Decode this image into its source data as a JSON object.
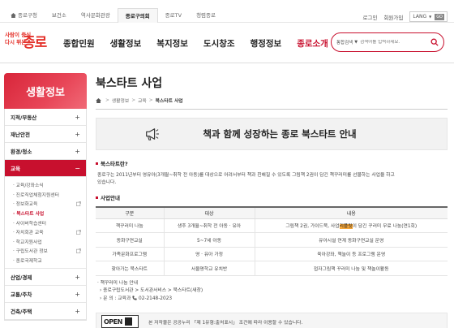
{
  "topnav": {
    "items": [
      {
        "label": "종로구청",
        "active": false
      },
      {
        "label": "보건소",
        "active": false
      },
      {
        "label": "역사문화관광",
        "active": false
      },
      {
        "label": "종로구의회",
        "active": true
      },
      {
        "label": "종로TV",
        "active": false
      },
      {
        "label": "청렴종로",
        "active": false
      }
    ],
    "login": "로그인",
    "join": "회원가입",
    "lang": "LANG",
    "lang_arrow": "▼",
    "go": "GO"
  },
  "header": {
    "logo": {
      "line1": "사람이 중심",
      "line2": "다시 뛰는",
      "name": "종로"
    },
    "gnb": [
      {
        "label": "종합민원",
        "active": false
      },
      {
        "label": "생활정보",
        "active": false
      },
      {
        "label": "복지정보",
        "active": false
      },
      {
        "label": "도시창조",
        "active": false
      },
      {
        "label": "행정정보",
        "active": false
      },
      {
        "label": "종로소개",
        "active": true
      }
    ],
    "search": {
      "scope": "통합검색",
      "arrow": "▼",
      "placeholder": "검색어를 입력하세요."
    }
  },
  "lnb": {
    "title": "생활정보",
    "menus_top": [
      {
        "label": "지적/부동산",
        "toggle": "+"
      },
      {
        "label": "재난안전",
        "toggle": "+"
      },
      {
        "label": "환경/청소",
        "toggle": "+"
      }
    ],
    "active_menu": {
      "label": "교육",
      "toggle": "−"
    },
    "subitems": [
      {
        "label": "· 교육/강좌소식",
        "ext": false,
        "active": false
      },
      {
        "label": "· 진로직업체험지원센터",
        "ext": false,
        "active": false
      },
      {
        "label": "· 정보화교육",
        "ext": true,
        "active": false
      },
      {
        "label": "· 북스타트 사업",
        "ext": false,
        "active": true
      },
      {
        "label": "· 사이버학습센터",
        "ext": false,
        "active": false
      },
      {
        "label": "· 자치회관 교육",
        "ext": true,
        "active": false
      },
      {
        "label": "· 학교지원사업",
        "ext": false,
        "active": false
      },
      {
        "label": "· 구립도서관 정보",
        "ext": true,
        "active": false
      },
      {
        "label": "· 종로국제학교",
        "ext": false,
        "active": false
      }
    ],
    "menus_bottom": [
      {
        "label": "산업/경제",
        "toggle": "+"
      },
      {
        "label": "교통/주차",
        "toggle": "+"
      },
      {
        "label": "건축/주택",
        "toggle": "+"
      }
    ]
  },
  "page": {
    "title": "북스타트 사업",
    "breadcrumb": {
      "home_sep": ">",
      "items": [
        "생활정보",
        "교육"
      ],
      "current": "북스타트 사업"
    },
    "banner": "책과 함께 성장하는 종로 북스타트 안내",
    "section1": {
      "title": "북스타트란?",
      "desc1": "종로구는 2011년부터 영유아(3개월~취학 전 아동)를 대상으로 어려서부터 책과 친해질 수 있도록 그림책 2권이 담긴 책꾸러미를 선물하는 사업을 하고",
      "desc2": "있습니다."
    },
    "section2": {
      "title": "사업안내",
      "headers": [
        "구분",
        "대상",
        "내용"
      ],
      "rows": [
        {
          "kind": "책꾸러미 나눔",
          "target": "생후 3개월~취학 전 아동 · 유아",
          "content_pre": "그림책 2권, 가이드북, 사업",
          "content_hl": "리플릿",
          "content_post": "이 담긴 꾸러미 무료 나눔(연1회)"
        },
        {
          "kind": "동화구연교실",
          "target": "5~7세 아동",
          "content_pre": "유아시설 연계 동화구연교실 운영",
          "content_hl": "",
          "content_post": ""
        },
        {
          "kind": "가족문화프로그램",
          "target": "영 · 유아 가정",
          "content_pre": "육아강좌, 책놀이 등 프로그램 운영",
          "content_hl": "",
          "content_post": ""
        },
        {
          "kind": "찾아가는 북스타트",
          "target": "서울명학교 유치반",
          "content_pre": "접자그림책 꾸러미 나눔 및 책놀이활동",
          "content_hl": "",
          "content_post": ""
        }
      ]
    },
    "notes": {
      "line1": "· 책꾸러미 나눔 안내",
      "line2": "› 종로구립도서관 > 도서관서비스 > 북스타트(새창)",
      "line3_prefix": "› 문 의 : 교육과",
      "phone": "02-2148-2023"
    },
    "ogl": {
      "badge": "OPEN",
      "text": "본 저작물은 공공누리 「제 1유형:출처표시」 조건에 따라 이용할 수 있습니다."
    }
  }
}
